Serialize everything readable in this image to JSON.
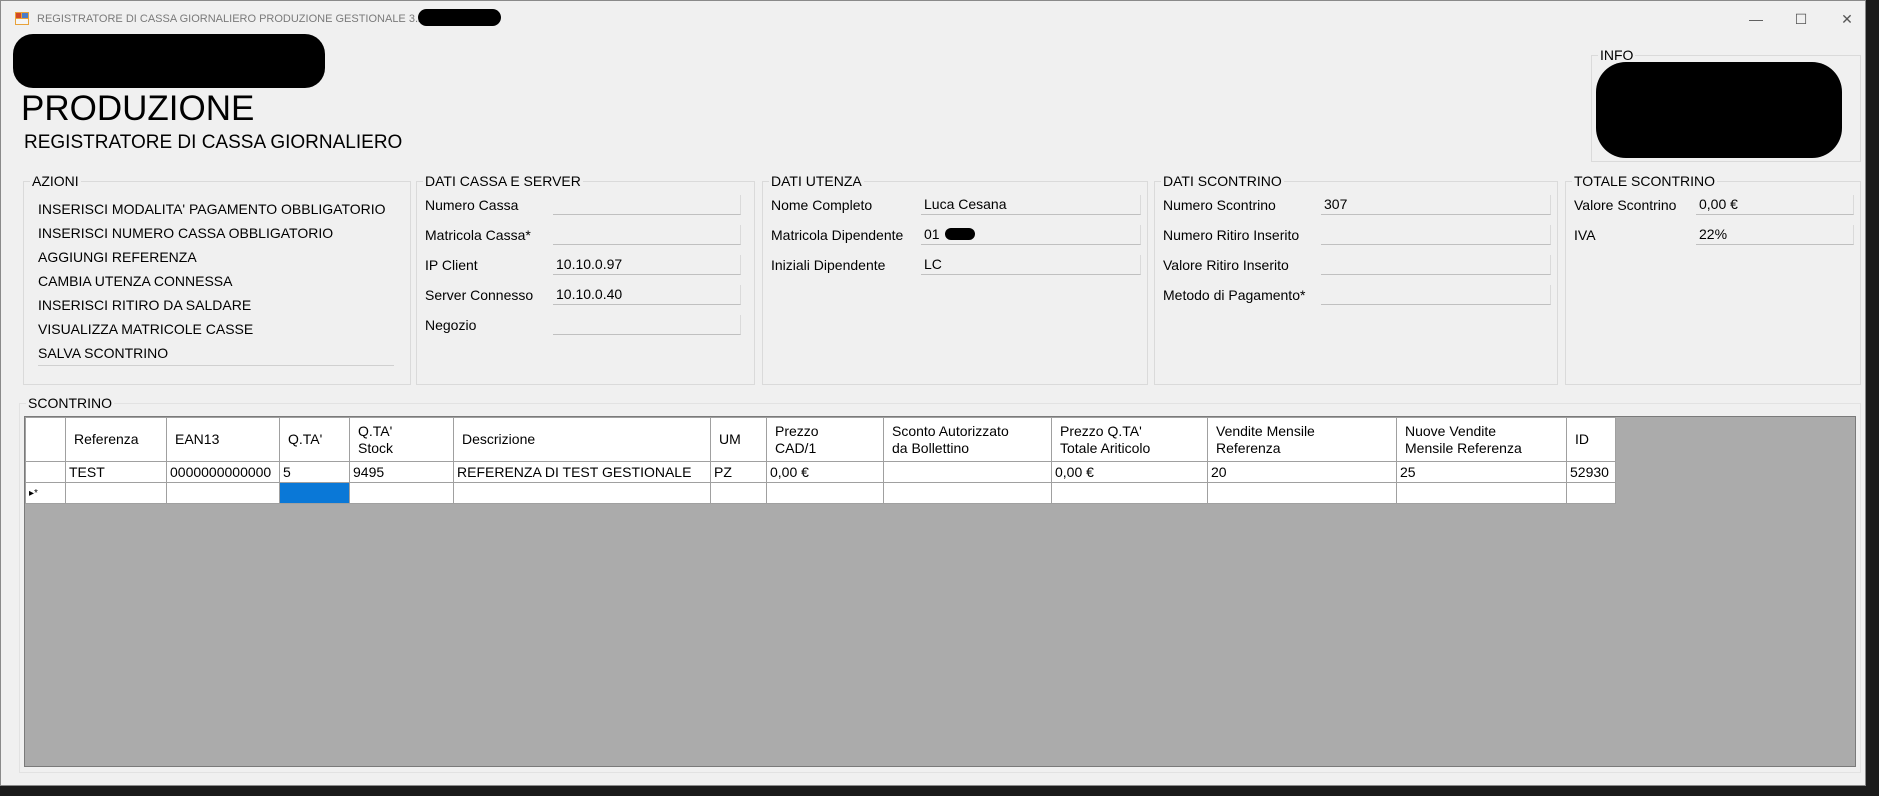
{
  "window": {
    "title": "REGISTRATORE DI CASSA GIORNALIERO PRODUZIONE GESTIONALE 3.2",
    "controls": {
      "minimize": "—",
      "maximize": "☐",
      "close": "✕"
    }
  },
  "header": {
    "title": "PRODUZIONE",
    "subtitle": "REGISTRATORE DI CASSA GIORNALIERO",
    "info_label": "INFO"
  },
  "azioni": {
    "title": "AZIONI",
    "items": [
      "INSERISCI MODALITA' PAGAMENTO OBBLIGATORIO",
      "INSERISCI NUMERO CASSA OBBLIGATORIO",
      "AGGIUNGI REFERENZA",
      "CAMBIA UTENZA CONNESSA",
      "INSERISCI RITIRO DA SALDARE",
      "VISUALIZZA MATRICOLE CASSE",
      "SALVA SCONTRINO"
    ]
  },
  "cassa": {
    "title": "DATI CASSA E SERVER",
    "fields": [
      {
        "label": "Numero Cassa",
        "value": ""
      },
      {
        "label": "Matricola Cassa*",
        "value": ""
      },
      {
        "label": "IP Client",
        "value": "10.10.0.97"
      },
      {
        "label": "Server Connesso",
        "value": "10.10.0.40"
      },
      {
        "label": "Negozio",
        "value": ""
      }
    ]
  },
  "utenza": {
    "title": "DATI UTENZA",
    "fields": [
      {
        "label": "Nome Completo",
        "value": "Luca Cesana"
      },
      {
        "label": "Matricola Dipendente",
        "value": "01"
      },
      {
        "label": "Iniziali Dipendente",
        "value": "LC"
      }
    ]
  },
  "scontrino_data": {
    "title": "DATI SCONTRINO",
    "fields": [
      {
        "label": "Numero Scontrino",
        "value": "307"
      },
      {
        "label": "Numero Ritiro Inserito",
        "value": ""
      },
      {
        "label": "Valore Ritiro Inserito",
        "value": ""
      },
      {
        "label": "Metodo di Pagamento*",
        "value": ""
      }
    ]
  },
  "totale": {
    "title": "TOTALE SCONTRINO",
    "fields": [
      {
        "label": "Valore Scontrino",
        "value": "0,00 €"
      },
      {
        "label": "IVA",
        "value": "22%"
      }
    ]
  },
  "grid": {
    "title": "SCONTRINO",
    "columns": [
      {
        "l1": "Referenza",
        "l2": ""
      },
      {
        "l1": "EAN13",
        "l2": ""
      },
      {
        "l1": "Q.TA'",
        "l2": ""
      },
      {
        "l1": "Q.TA'",
        "l2": "Stock"
      },
      {
        "l1": "Descrizione",
        "l2": ""
      },
      {
        "l1": "UM",
        "l2": ""
      },
      {
        "l1": "Prezzo",
        "l2": "CAD/1"
      },
      {
        "l1": "Sconto Autorizzato",
        "l2": "da Bollettino"
      },
      {
        "l1": "Prezzo Q.TA'",
        "l2": "Totale Ariticolo"
      },
      {
        "l1": "Vendite Mensile",
        "l2": "Referenza"
      },
      {
        "l1": "Nuove Vendite",
        "l2": "Mensile Referenza"
      },
      {
        "l1": "ID",
        "l2": ""
      }
    ],
    "rows": [
      [
        "TEST",
        "0000000000000",
        "5",
        "9495",
        "REFERENZA DI TEST GESTIONALE",
        "PZ",
        "0,00 €",
        "",
        "0,00 €",
        "20",
        "25",
        "52930"
      ]
    ],
    "new_row_indicator": "▸*"
  }
}
